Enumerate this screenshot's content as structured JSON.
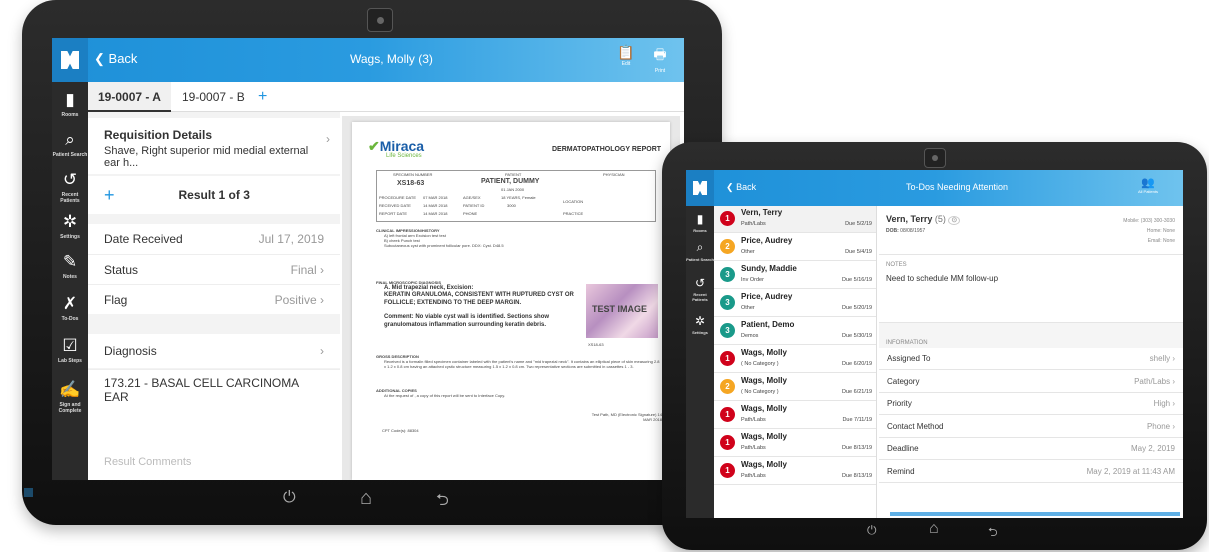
{
  "tablet1": {
    "header": {
      "back_label": "Back",
      "title": "Wags, Molly (3)",
      "edit_label": "Edit",
      "print_label": "Print"
    },
    "sidebar": [
      {
        "label": "Rooms",
        "icon": "door-icon"
      },
      {
        "label": "Patient Search",
        "icon": "search-icon"
      },
      {
        "label": "Recent Patients",
        "icon": "history-icon"
      },
      {
        "label": "Settings",
        "icon": "gear-icon"
      },
      {
        "label": "Notes",
        "icon": "pencil-icon"
      },
      {
        "label": "To-Dos",
        "icon": "pin-icon"
      },
      {
        "label": "Lab Steps",
        "icon": "clipboard-check-icon"
      },
      {
        "label": "Sign and Complete",
        "icon": "signature-icon"
      }
    ],
    "tabs": [
      "19-0007 - A",
      "19-0007 - B",
      "+"
    ],
    "requisition": {
      "title": "Requisition Details",
      "desc": "Shave, Right superior mid medial external ear h..."
    },
    "result": {
      "add": "+",
      "label": "Result 1 of 3"
    },
    "fields": [
      {
        "label": "Date Received",
        "value": "Jul 17, 2019"
      },
      {
        "label": "Status",
        "value": "Final"
      },
      {
        "label": "Flag",
        "value": "Positive"
      }
    ],
    "diagnosis": {
      "label": "Diagnosis",
      "value": "173.21 - BASAL CELL CARCINOMA EAR"
    },
    "comments": {
      "heading": "RESULT COMMENTS",
      "placeholder": "Result Comments"
    },
    "report": {
      "brand": "Miraca",
      "brand_sub": "Life Sciences",
      "title": "DERMATOPATHOLOGY REPORT",
      "col_specimen": "SPECIMEN NUMBER",
      "col_patient": "PATIENT",
      "col_physician": "PHYSICIAN",
      "specimen": "XS18-63",
      "patient": "PATIENT, DUMMY",
      "dob": "01 JAN 2000",
      "proc_date_label": "PROCEDURE DATE",
      "proc_date": "07 MAR 2018",
      "recv_label": "RECEIVED DATE",
      "recv": "14 MAR 2018",
      "rep_label": "REPORT DATE",
      "rep": "14 MAR 2018",
      "age_label": "AGE/SEX",
      "age": "18 YEARS, Female",
      "pid_label": "PATIENT ID",
      "pid": "3000",
      "phone_label": "PHONE",
      "loc_label": "LOCATION",
      "practice_label": "PRACTICE",
      "clin_heading": "CLINICAL IMPRESSION/HISTORY",
      "clin_lines": [
        "A) left frontal arm Excision test test",
        "B) cheek Punch test",
        "Subcutaneous cyst with prominent follicular pore. DDX: Cyst. D48.5"
      ],
      "final_heading": "FINAL MICROSCOPIC DIAGNOSIS",
      "final_a": "A. Mid trapezial neck, Excision:",
      "final_dx": "KERATIN GRANULOMA, CONSISTENT WITH RUPTURED CYST OR FOLLICLE; EXTENDING TO THE DEEP MARGIN.",
      "comment": "Comment: No viable cyst wall is identified. Sections show granulomatous inflammation surrounding keratin debris.",
      "image_label": "TEST IMAGE",
      "image_caption": "XS18-63",
      "gross_heading": "GROSS DESCRIPTION",
      "gross": "Received is a formalin filled specimen container labeled with the patient's name and \"mid trapezial neck\". It contains an elliptical piece of skin measuring 2.8 x 1.2 x 0.8 cm having an attached cystic structure measuring 1.5 x 1.2 x 0.8 cm. Two representative sections are submitted in cassettes 1 - 3.",
      "copies_heading": "ADDITIONAL COPIES",
      "copies": "At the request of , a copy of this report will be sent to Interface Copy.",
      "cpt": "CPT Code(s): 88304",
      "signed": "Test Path, MD (Electronic Signature) 14 MAR 2018"
    }
  },
  "tablet2": {
    "header": {
      "back_label": "Back",
      "title": "To-Dos Needing Attention",
      "patients_label": "All Patients"
    },
    "sidebar": [
      {
        "label": "Rooms",
        "icon": "door-icon"
      },
      {
        "label": "Patient Search",
        "icon": "search-icon"
      },
      {
        "label": "Recent Patients",
        "icon": "history-icon"
      },
      {
        "label": "Settings",
        "icon": "gear-icon"
      }
    ],
    "todos": [
      {
        "n": "1",
        "name": "Vern, Terry",
        "cat": "Path/Labs",
        "due": "Due 5/2/19",
        "color": "#d0021b"
      },
      {
        "n": "2",
        "name": "Price, Audrey",
        "cat": "Other",
        "due": "Due 5/4/19",
        "color": "#f5a623"
      },
      {
        "n": "3",
        "name": "Sundy, Maddie",
        "cat": "Inv Order",
        "due": "Due 5/16/19",
        "color": "#1a9a8a"
      },
      {
        "n": "3",
        "name": "Price, Audrey",
        "cat": "Other",
        "due": "Due 5/20/19",
        "color": "#1a9a8a"
      },
      {
        "n": "3",
        "name": "Patient, Demo",
        "cat": "Demos",
        "due": "Due 5/30/19",
        "color": "#1a9a8a"
      },
      {
        "n": "1",
        "name": "Wags, Molly",
        "cat": "( No Category )",
        "due": "Due 6/20/19",
        "color": "#d0021b"
      },
      {
        "n": "2",
        "name": "Wags, Molly",
        "cat": "( No Category )",
        "due": "Due 6/21/19",
        "color": "#f5a623"
      },
      {
        "n": "1",
        "name": "Wags, Molly",
        "cat": "Path/Labs",
        "due": "Due 7/11/19",
        "color": "#d0021b"
      },
      {
        "n": "1",
        "name": "Wags, Molly",
        "cat": "Path/Labs",
        "due": "Due 8/13/19",
        "color": "#d0021b"
      },
      {
        "n": "1",
        "name": "Wags, Molly",
        "cat": "Path/Labs",
        "due": "Due 8/13/19",
        "color": "#d0021b"
      }
    ],
    "detail": {
      "name": "Vern, Terry",
      "count": "(5)",
      "dob_label": "DOB:",
      "dob": "08/08/1957",
      "mobile": "Mobile: (303) 300-3030",
      "home": "Home: None",
      "email": "Email: None",
      "notes_heading": "NOTES",
      "note": "Need to schedule MM follow-up",
      "info_heading": "INFORMATION",
      "info": [
        {
          "label": "Assigned To",
          "value": "shelly"
        },
        {
          "label": "Category",
          "value": "Path/Labs"
        },
        {
          "label": "Priority",
          "value": "High"
        },
        {
          "label": "Contact Method",
          "value": "Phone"
        },
        {
          "label": "Deadline",
          "value": "May 2, 2019"
        },
        {
          "label": "Remind",
          "value": "May 2, 2019 at 11:43 AM"
        }
      ]
    }
  }
}
